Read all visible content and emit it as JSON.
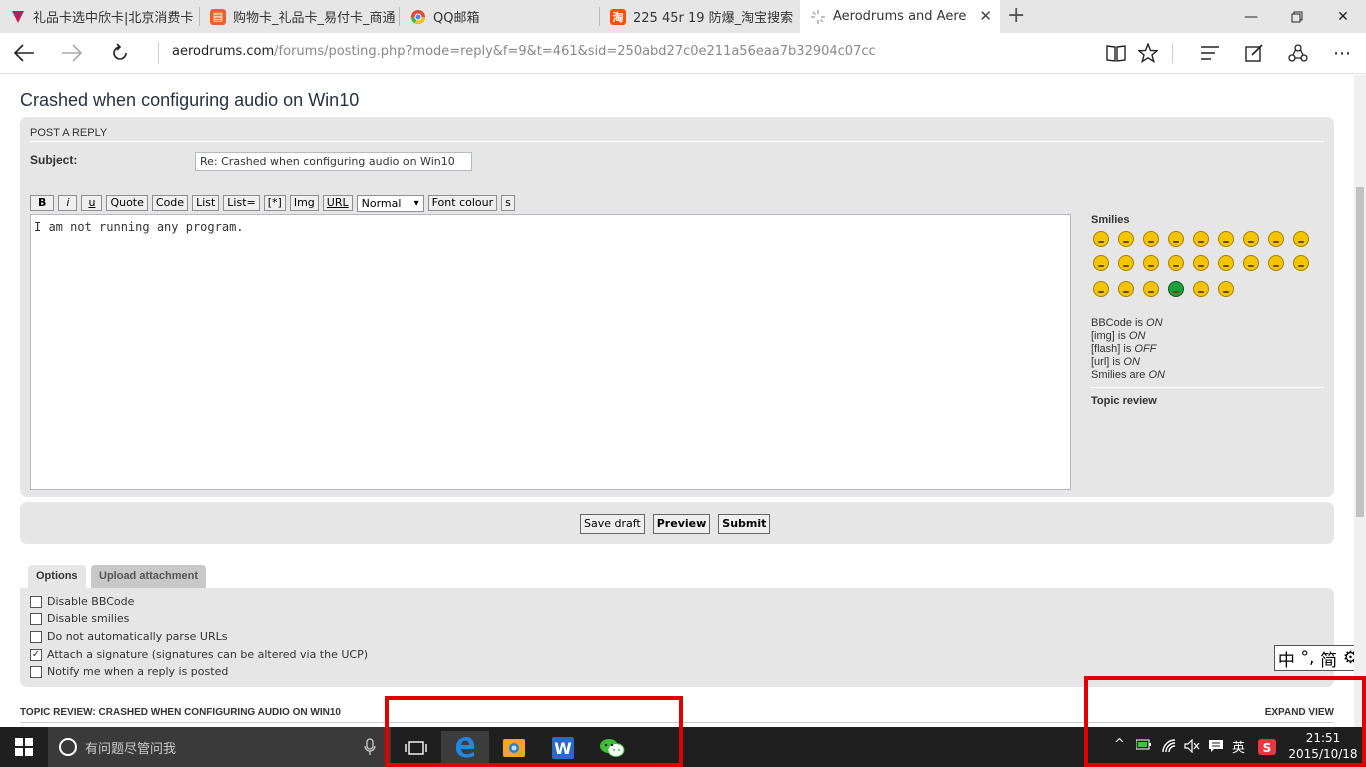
{
  "tabs": [
    {
      "label": "礼品卡选中欣卡|北京消费卡",
      "icon": "shop-icon"
    },
    {
      "label": "购物卡_礼品卡_易付卡_商通",
      "icon": "shop-icon"
    },
    {
      "label": "QQ邮箱",
      "icon": "chrome-icon"
    },
    {
      "label": "225 45r 19 防爆_淘宝搜索",
      "icon": "taobao-icon"
    },
    {
      "label": "Aerodrums and Aered fo",
      "icon": "loading-icon"
    }
  ],
  "address": {
    "host": "aerodrums.com",
    "path": "/forums/posting.php?mode=reply&f=9&t=461&sid=250abd27c0e211a56eaa7b32904c07cc"
  },
  "topic_title": "Crashed when configuring audio on Win10",
  "post_reply": {
    "heading": "POST A REPLY",
    "subject_label": "Subject:",
    "subject_value": "Re: Crashed when configuring audio on Win10",
    "toolbar": [
      "B",
      "i",
      "u",
      "Quote",
      "Code",
      "List",
      "List=",
      "[*]",
      "Img",
      "URL"
    ],
    "font_size": "Normal",
    "font_colour": "Font colour",
    "strike": "s",
    "message": "I am not running any program."
  },
  "smilies": {
    "title": "Smilies",
    "bbcode": [
      {
        "label": "BBCode is ",
        "state": "ON"
      },
      {
        "label": "[img] is ",
        "state": "ON"
      },
      {
        "label": "[flash] is ",
        "state": "OFF"
      },
      {
        "label": "[url] is ",
        "state": "ON"
      },
      {
        "label": "Smilies are ",
        "state": "ON"
      }
    ],
    "topic_review": "Topic review"
  },
  "buttons": {
    "save_draft": "Save draft",
    "preview": "Preview",
    "submit": "Submit"
  },
  "option_tabs": {
    "options": "Options",
    "upload": "Upload attachment"
  },
  "options": [
    {
      "label": "Disable BBCode",
      "checked": false
    },
    {
      "label": "Disable smilies",
      "checked": false
    },
    {
      "label": "Do not automatically parse URLs",
      "checked": false
    },
    {
      "label": "Attach a signature (signatures can be altered via the UCP)",
      "checked": true
    },
    {
      "label": "Notify me when a reply is posted",
      "checked": false
    }
  ],
  "topic_review_bar": {
    "title": "TOPIC REVIEW: CRASHED WHEN CONFIGURING AUDIO ON WIN10",
    "expand": "EXPAND VIEW"
  },
  "ime": {
    "lang": "中",
    "punct": "°,",
    "mode": "简"
  },
  "taskbar": {
    "search_placeholder": "有问题尽管问我",
    "ime_indicator": "英",
    "time": "21:51",
    "date": "2015/10/18"
  },
  "colors": {
    "panel": "#e6e6e6",
    "highlight": "#e10000",
    "taskbar": "#1f1f1f"
  }
}
